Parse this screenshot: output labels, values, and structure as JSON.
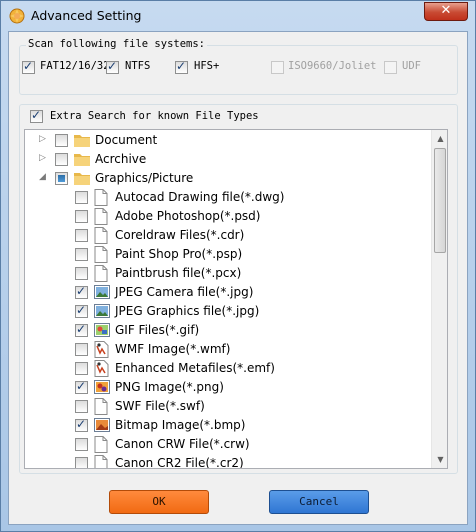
{
  "window": {
    "title": "Advanced Setting",
    "close_label": "✕"
  },
  "filesystems": {
    "group_label": "Scan following file systems:",
    "items": [
      {
        "label": "FAT12/16/32",
        "checked": true,
        "enabled": true
      },
      {
        "label": "NTFS",
        "checked": true,
        "enabled": true
      },
      {
        "label": "HFS+",
        "checked": true,
        "enabled": true
      },
      {
        "label": "ISO9660/Joliet",
        "checked": false,
        "enabled": false
      },
      {
        "label": "UDF",
        "checked": false,
        "enabled": false
      }
    ]
  },
  "filetypes": {
    "header_label": "Extra Search for known File Types",
    "header_checked": true,
    "tree": [
      {
        "label": "Document",
        "level": 0,
        "expander": "collapsed",
        "state": "unchecked",
        "icon": "folder-icon"
      },
      {
        "label": "Acrchive",
        "level": 0,
        "expander": "collapsed",
        "state": "unchecked",
        "icon": "folder-icon"
      },
      {
        "label": "Graphics/Picture",
        "level": 0,
        "expander": "expanded",
        "state": "partial",
        "icon": "folder-icon"
      },
      {
        "label": "Autocad Drawing file(*.dwg)",
        "level": 1,
        "state": "unchecked",
        "icon": "blank-file-icon"
      },
      {
        "label": "Adobe Photoshop(*.psd)",
        "level": 1,
        "state": "unchecked",
        "icon": "blank-file-icon"
      },
      {
        "label": "Coreldraw Files(*.cdr)",
        "level": 1,
        "state": "unchecked",
        "icon": "blank-file-icon"
      },
      {
        "label": "Paint Shop Pro(*.psp)",
        "level": 1,
        "state": "unchecked",
        "icon": "blank-file-icon"
      },
      {
        "label": "Paintbrush file(*.pcx)",
        "level": 1,
        "state": "unchecked",
        "icon": "blank-file-icon"
      },
      {
        "label": "JPEG Camera file(*.jpg)",
        "level": 1,
        "state": "checked",
        "icon": "jpeg-image-icon"
      },
      {
        "label": "JPEG Graphics file(*.jpg)",
        "level": 1,
        "state": "checked",
        "icon": "jpeg-image-icon"
      },
      {
        "label": "GIF Files(*.gif)",
        "level": 1,
        "state": "checked",
        "icon": "gif-image-icon"
      },
      {
        "label": "WMF Image(*.wmf)",
        "level": 1,
        "state": "unchecked",
        "icon": "wmf-image-icon"
      },
      {
        "label": "Enhanced Metafiles(*.emf)",
        "level": 1,
        "state": "unchecked",
        "icon": "emf-image-icon"
      },
      {
        "label": "PNG Image(*.png)",
        "level": 1,
        "state": "checked",
        "icon": "png-image-icon"
      },
      {
        "label": "SWF File(*.swf)",
        "level": 1,
        "state": "unchecked",
        "icon": "blank-file-icon"
      },
      {
        "label": "Bitmap Image(*.bmp)",
        "level": 1,
        "state": "checked",
        "icon": "bitmap-image-icon"
      },
      {
        "label": "Canon CRW File(*.crw)",
        "level": 1,
        "state": "unchecked",
        "icon": "blank-file-icon"
      },
      {
        "label": "Canon CR2 File(*.cr2)",
        "level": 1,
        "state": "unchecked",
        "icon": "blank-file-icon"
      }
    ]
  },
  "buttons": {
    "ok_label": "OK",
    "cancel_label": "Cancel"
  },
  "colors": {
    "ok_button": "#f16a12",
    "cancel_button": "#2f76d3"
  }
}
